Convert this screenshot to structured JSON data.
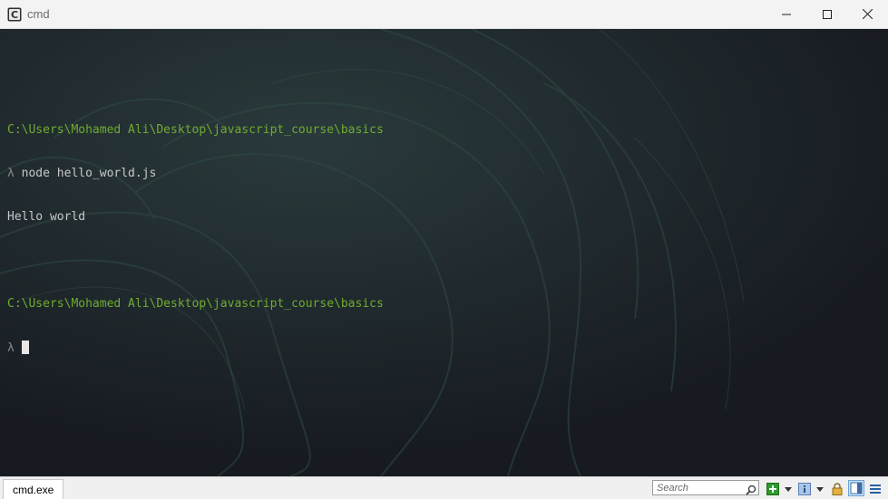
{
  "window": {
    "title": "cmd",
    "icon": "cmder-icon"
  },
  "window_controls": {
    "minimize_icon": "minimize-icon",
    "maximize_icon": "maximize-icon",
    "close_icon": "close-icon"
  },
  "terminal": {
    "lines": [
      {
        "type": "blank",
        "text": ""
      },
      {
        "type": "path",
        "text": "C:\\Users\\Mohamed Ali\\Desktop\\javascript_course\\basics"
      },
      {
        "type": "command",
        "prompt": "λ",
        "text": "node hello_world.js"
      },
      {
        "type": "output",
        "text": "Hello world"
      },
      {
        "type": "blank",
        "text": ""
      },
      {
        "type": "path",
        "text": "C:\\Users\\Mohamed Ali\\Desktop\\javascript_course\\basics"
      },
      {
        "type": "input",
        "prompt": "λ",
        "text": ""
      }
    ],
    "colors": {
      "path": "#6fac2e",
      "prompt": "#8a8a8a",
      "text": "#c8c8c8",
      "background": "#181c22"
    }
  },
  "statusbar": {
    "tab_label": "cmd.exe",
    "search_placeholder": "Search",
    "icons": [
      "search-icon",
      "new-console-icon",
      "dropdown-arrow-icon",
      "console-info-icon",
      "dropdown-arrow-icon",
      "lock-icon",
      "split-view-icon",
      "menu-icon"
    ]
  }
}
